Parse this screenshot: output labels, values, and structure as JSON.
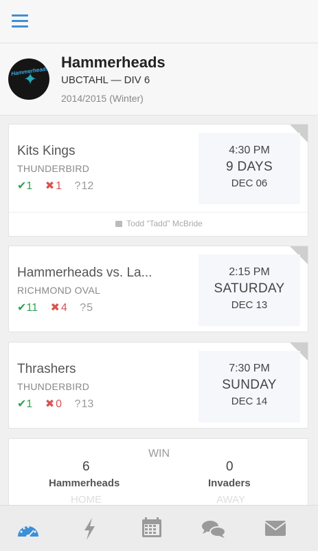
{
  "team": {
    "name": "Hammerheads",
    "league": "UBCTAHL — DIV 6",
    "season": "2014/2015 (Winter)",
    "logo_text": "Hammerheads"
  },
  "games": [
    {
      "opponent": "Kits Kings",
      "venue": "THUNDERBIRD",
      "in_count": "1",
      "out_count": "1",
      "maybe_count": "12",
      "time": "4:30 PM",
      "day": "9 DAYS",
      "date": "DEC 06",
      "captain": "Todd “Tadd” McBride"
    },
    {
      "opponent": "Hammerheads vs. La...",
      "venue": "RICHMOND OVAL",
      "in_count": "11",
      "out_count": "4",
      "maybe_count": "5",
      "time": "2:15 PM",
      "day": "SATURDAY",
      "date": "DEC 13"
    },
    {
      "opponent": "Thrashers",
      "venue": "THUNDERBIRD",
      "in_count": "1",
      "out_count": "0",
      "maybe_count": "13",
      "time": "7:30 PM",
      "day": "SUNDAY",
      "date": "DEC 14"
    }
  ],
  "last_result": {
    "outcome": "WIN",
    "home_score": "6",
    "home_team": "Hammerheads",
    "home_label": "HOME",
    "away_score": "0",
    "away_team": "Invaders",
    "away_label": "AWAY"
  },
  "tabs": [
    {
      "icon": "dashboard-icon",
      "active": true
    },
    {
      "icon": "lightning-icon",
      "active": false
    },
    {
      "icon": "calendar-icon",
      "active": false
    },
    {
      "icon": "chat-icon",
      "active": false
    },
    {
      "icon": "mail-icon",
      "active": false
    }
  ],
  "colors": {
    "accent": "#3d8fd6",
    "in": "#2ea44f",
    "out": "#d9534f",
    "inactive_icon": "#9a9a9a"
  }
}
